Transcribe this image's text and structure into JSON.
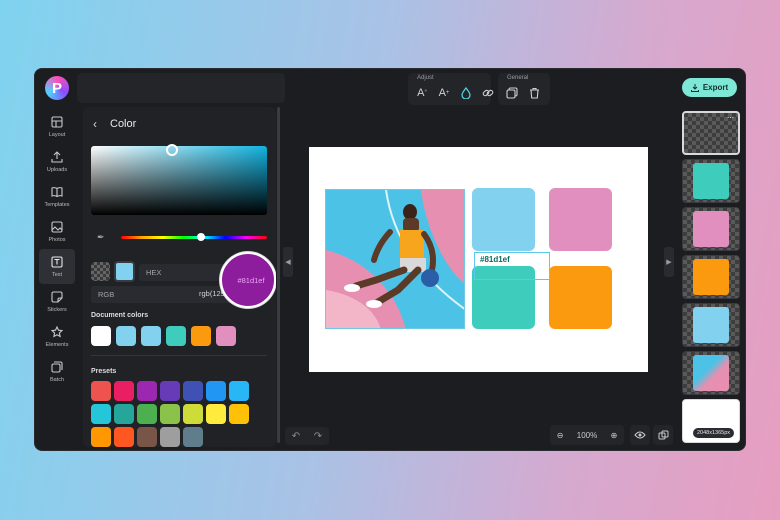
{
  "app": {
    "logo_letter": "P"
  },
  "toolbar": {
    "adjust_label": "Adjust",
    "general_label": "General",
    "export_label": "Export"
  },
  "sidebar": {
    "items": [
      {
        "label": "Layout",
        "icon": "layout-icon"
      },
      {
        "label": "Uploads",
        "icon": "upload-icon"
      },
      {
        "label": "Templates",
        "icon": "book-icon"
      },
      {
        "label": "Photos",
        "icon": "image-icon"
      },
      {
        "label": "Text",
        "icon": "text-icon",
        "active": true
      },
      {
        "label": "Stickers",
        "icon": "sticker-icon"
      },
      {
        "label": "Elements",
        "icon": "star-icon"
      },
      {
        "label": "Batch",
        "icon": "batch-icon"
      }
    ]
  },
  "color_panel": {
    "title": "Color",
    "hex_label": "HEX",
    "hex_value": "#81d1ef",
    "rgb_label": "RGB",
    "rgb_value": "rgb(129, 209, 239)",
    "document_colors_label": "Document colors",
    "presets_label": "Presets",
    "selected_color": "#81d1ef",
    "document_colors": [
      "#ffffff",
      "#81d1ef",
      "#81d1ef",
      "#3ecdbd",
      "#fb9a0e",
      "#e08fbf"
    ],
    "presets": [
      "#ef5350",
      "#e91e63",
      "#9c27b0",
      "#673ab7",
      "#3f51b5",
      "#2196f3",
      "#29b6f6",
      "#26c6da",
      "#26a69a",
      "#4caf50",
      "#8bc34a",
      "#cddc39",
      "#ffeb3b",
      "#ffc107",
      "#ff9800",
      "#ff5722",
      "#795548",
      "#9e9e9e",
      "#607d8b"
    ]
  },
  "canvas": {
    "hex_tag": "#81d1ef",
    "squares": {
      "sky": "#81d1ef",
      "pink": "#e08fbf",
      "teal": "#3ecdbd",
      "orange": "#fb9a0e"
    },
    "zoom": "100%"
  },
  "pages": {
    "size_label": "2048x1365px"
  }
}
